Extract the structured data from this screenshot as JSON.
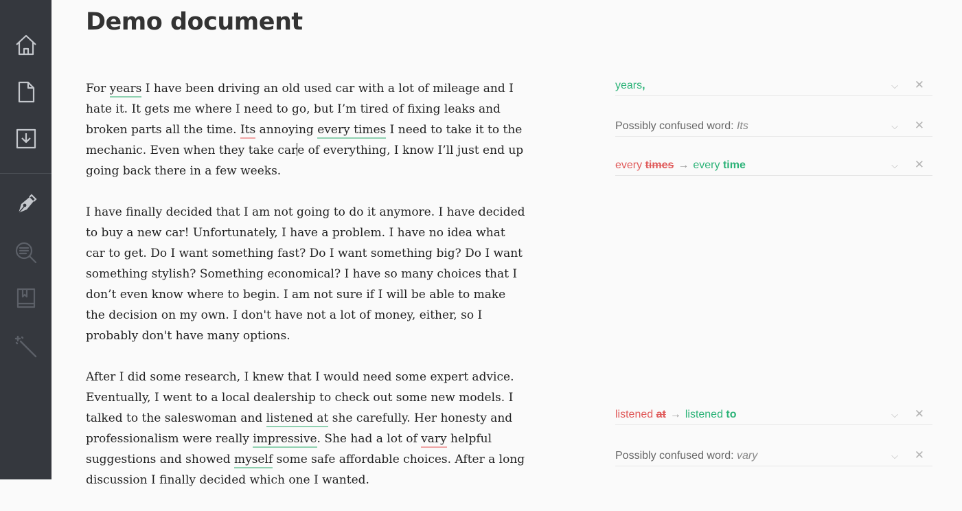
{
  "sidebar": {
    "icons": [
      "home-icon",
      "document-icon",
      "download-icon",
      "pen-icon",
      "search-lines-icon",
      "bookmark-book-icon",
      "magic-wand-icon"
    ]
  },
  "document": {
    "title": "Demo document",
    "p1": {
      "t0": "For ",
      "w_years": "years",
      "t1": " I have been driving an old used car with a lot of mileage and I hate it. It gets me where I need to go, but I’m tired of fixing leaks and broken parts all the time. ",
      "w_its": "Its",
      "t2": " annoying ",
      "w_every_times": "every times",
      "t3": " I need to take it to the mechanic. Even when they take car",
      "t4": "e of everything, I know I’ll just end up going back there in a few weeks."
    },
    "p2": "I have finally decided that I am not going to do it anymore. I have decided to buy a new car! Unfortunately, I have a problem. I have no idea what car to get. Do I want something fast? Do I want something big? Do I want something stylish? Something economical? I have so many choices that I don’t even know where to begin. I am not sure if I will be able to make the decision on my own. I don't have not a lot of money, either, so I probably don't have many options.",
    "p3": {
      "t0": "After I did some research, I knew that I would need some expert advice. Eventually, I went to a local dealership to check out some new models. I talked to the saleswoman and ",
      "w_listened_at": "listened at",
      "t1": " she carefully. Her honesty and professionalism were really ",
      "w_impressive": "impressive",
      "t2": ". She had a lot of ",
      "w_vary": "vary",
      "t3": " helpful suggestions and showed ",
      "w_myself": "myself",
      "t4": " some safe affordable choices. After a long discussion I finally decided which one I wanted."
    }
  },
  "suggestions": [
    {
      "green_text": "years",
      "punct": ","
    },
    {
      "label": "Possibly confused word: ",
      "word": "Its"
    },
    {
      "orig_prefix": "every ",
      "orig_strike": "times",
      "arrow": "→",
      "fix_prefix": "every ",
      "fix_bold": "time"
    },
    {
      "orig_prefix": "listened ",
      "orig_strike": "at",
      "arrow": "→",
      "fix_prefix": "listened ",
      "fix_bold": "to"
    },
    {
      "label": "Possibly confused word: ",
      "word": "vary"
    }
  ],
  "card_actions": {
    "expand_glyph": "⌵",
    "dismiss_glyph": "✕"
  },
  "colors": {
    "sidebar_bg": "#35383e",
    "accent_green": "#2cb378",
    "accent_red": "#e05a5a",
    "icon_gray": "#b9bcc1"
  }
}
